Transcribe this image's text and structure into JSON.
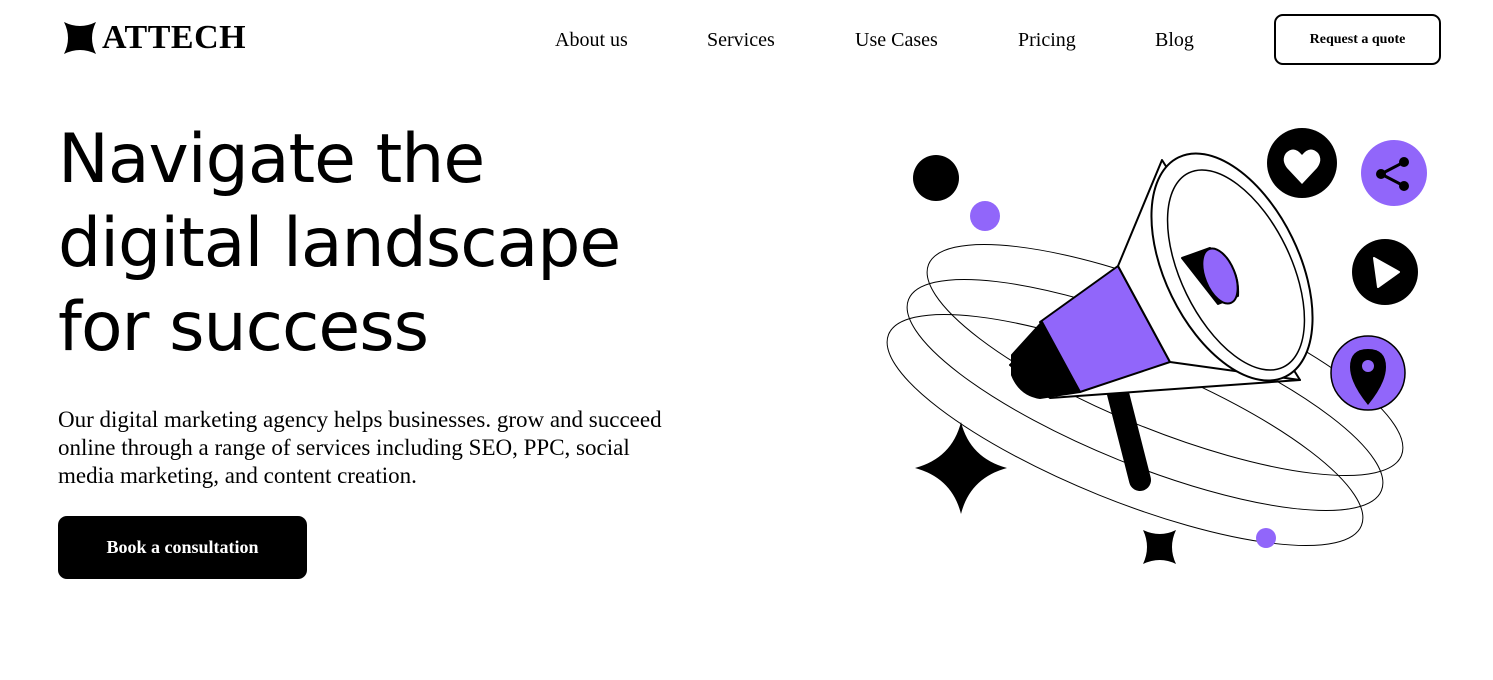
{
  "brand": {
    "name": "ATTECH",
    "logo_icon": "four-point-star-logo-icon"
  },
  "nav": {
    "items": [
      {
        "label": "About us"
      },
      {
        "label": "Services"
      },
      {
        "label": "Use Cases"
      },
      {
        "label": "Pricing"
      },
      {
        "label": "Blog"
      }
    ],
    "cta_label": "Request a quote"
  },
  "hero": {
    "headline_lines": [
      "Navigate the",
      "digital landscape",
      "for success"
    ],
    "description": "Our digital marketing agency helps businesses. grow and succeed online through a range of services including SEO, PPC, social media marketing, and content creation.",
    "cta_label": "Book a consultation"
  },
  "illustration": {
    "icons": [
      "megaphone-icon",
      "heart-icon",
      "share-icon",
      "play-icon",
      "location-pin-icon",
      "sparkle-star-icon"
    ]
  },
  "colors": {
    "accent": "#9166fa",
    "ink": "#000000",
    "background": "#ffffff"
  }
}
